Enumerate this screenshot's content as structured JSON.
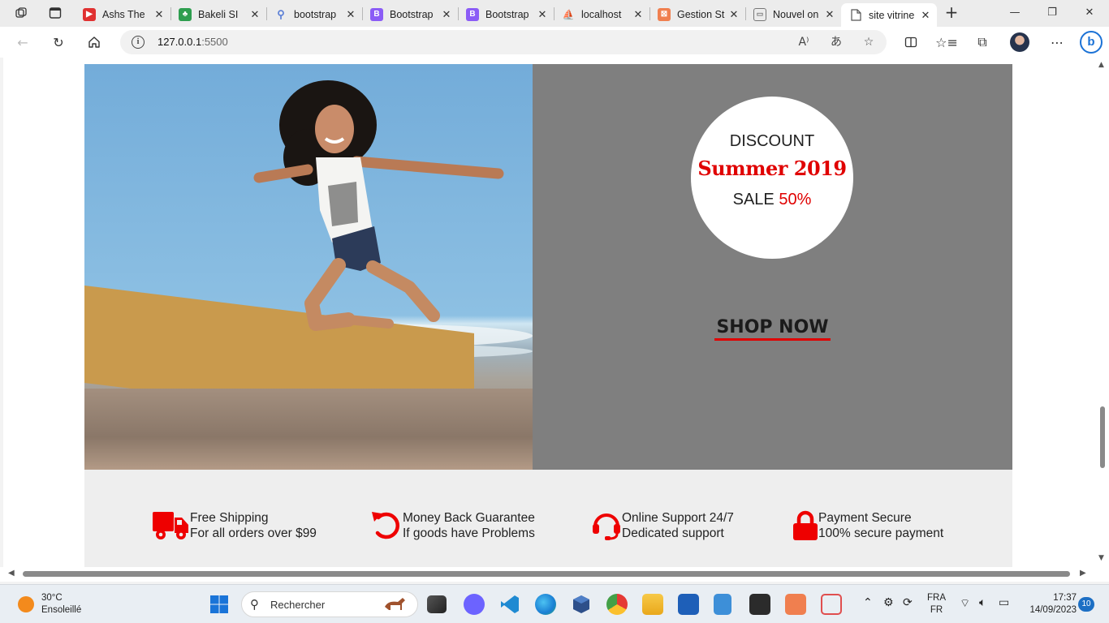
{
  "browser": {
    "tabs": [
      {
        "title": "Ashs The",
        "favicon": "youtube-icon",
        "color": "#e03131"
      },
      {
        "title": "Bakeli SI",
        "favicon": "bakeli-icon",
        "color": "#2e9e4f"
      },
      {
        "title": "bootstrap",
        "favicon": "search-icon",
        "color": "#5b7fd6"
      },
      {
        "title": "Bootstrap",
        "favicon": "bootstrap-icon",
        "color": "#8b5cf6"
      },
      {
        "title": "Bootstrap",
        "favicon": "bootstrap-icon",
        "color": "#8b5cf6"
      },
      {
        "title": "localhost",
        "favicon": "phpmyadmin-icon",
        "color": "#e8a13a"
      },
      {
        "title": "Gestion St",
        "favicon": "xampp-icon",
        "color": "#f07f4f"
      },
      {
        "title": "Nouvel on",
        "favicon": "page-icon",
        "color": "#777777"
      },
      {
        "title": "site vitrine",
        "favicon": "document-icon",
        "color": "#666666",
        "active": true
      }
    ],
    "address": {
      "host": "127.0.0.1",
      "port": ":5500"
    }
  },
  "page": {
    "promo": {
      "discount_label": "DISCOUNT",
      "headline": "Summer 2019",
      "sale_label": "SALE",
      "sale_percent": "50%",
      "cta": "SHOP NOW"
    },
    "features": [
      {
        "icon": "truck-icon",
        "title": "Free Shipping",
        "subtitle": "For all orders over $99"
      },
      {
        "icon": "undo-icon",
        "title": "Money Back Guarantee",
        "subtitle": "If goods have Problems"
      },
      {
        "icon": "headset-icon",
        "title": "Online Support 24/7",
        "subtitle": "Dedicated support"
      },
      {
        "icon": "lock-icon",
        "title": "Payment Secure",
        "subtitle": "100% secure payment"
      }
    ],
    "accent_color": "#e00000"
  },
  "taskbar": {
    "weather": {
      "temp": "30°C",
      "condition": "Ensoleillé"
    },
    "search_placeholder": "Rechercher",
    "language": {
      "top": "FRA",
      "bottom": "FR"
    },
    "clock": {
      "time": "17:37",
      "date": "14/09/2023"
    },
    "notifications": "10"
  }
}
